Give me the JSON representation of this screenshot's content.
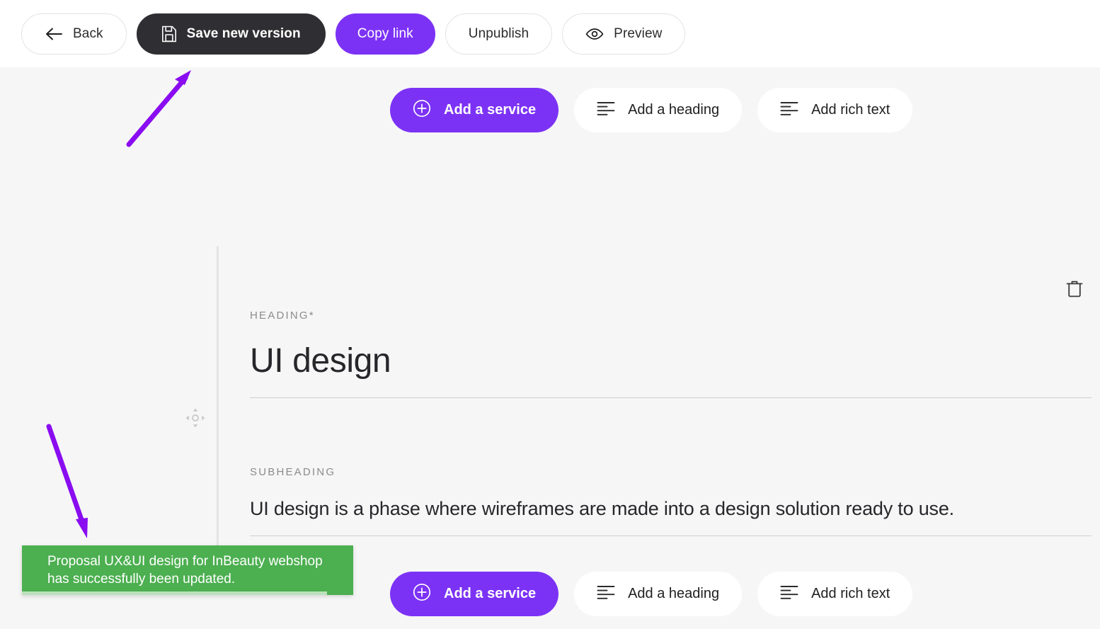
{
  "toolbar": {
    "buttons": [
      {
        "id": "back",
        "label": "Back",
        "icon": "arrow-left-icon",
        "style": "outline"
      },
      {
        "id": "save",
        "label": "Save new version",
        "icon": "floppy-disk-icon",
        "style": "dark"
      },
      {
        "id": "copy",
        "label": "Copy link",
        "icon": "none",
        "style": "purple"
      },
      {
        "id": "unpub",
        "label": "Unpublish",
        "icon": "none",
        "style": "outline"
      },
      {
        "id": "preview",
        "label": "Preview",
        "icon": "eye-icon",
        "style": "outline"
      }
    ]
  },
  "add_row": {
    "service_label": "Add a service",
    "heading_label": "Add a heading",
    "richtext_label": "Add rich text"
  },
  "block": {
    "heading_label": "HEADING*",
    "heading_value": "UI design",
    "subheading_label": "SUBHEADING",
    "subheading_value": "UI design is a phase where wireframes are made into a design solution ready to use.",
    "drag_handle_name": "move-handle-icon",
    "delete_name": "trash-icon"
  },
  "toast": {
    "message": "Proposal UX&UI design for InBeauty webshop has successfully been updated.",
    "color": "#4caf50"
  },
  "colors": {
    "accent_purple": "#7c32f5",
    "dark_button": "#2f2f33",
    "page_background": "#f6f6f6",
    "toolbar_background": "#ffffff",
    "success_green": "#4caf50",
    "annotation_purple": "#8a0cf0"
  },
  "annotations": [
    {
      "name": "arrow-to-save-button",
      "direction": "up-right"
    },
    {
      "name": "arrow-to-toast",
      "direction": "down-right"
    }
  ]
}
